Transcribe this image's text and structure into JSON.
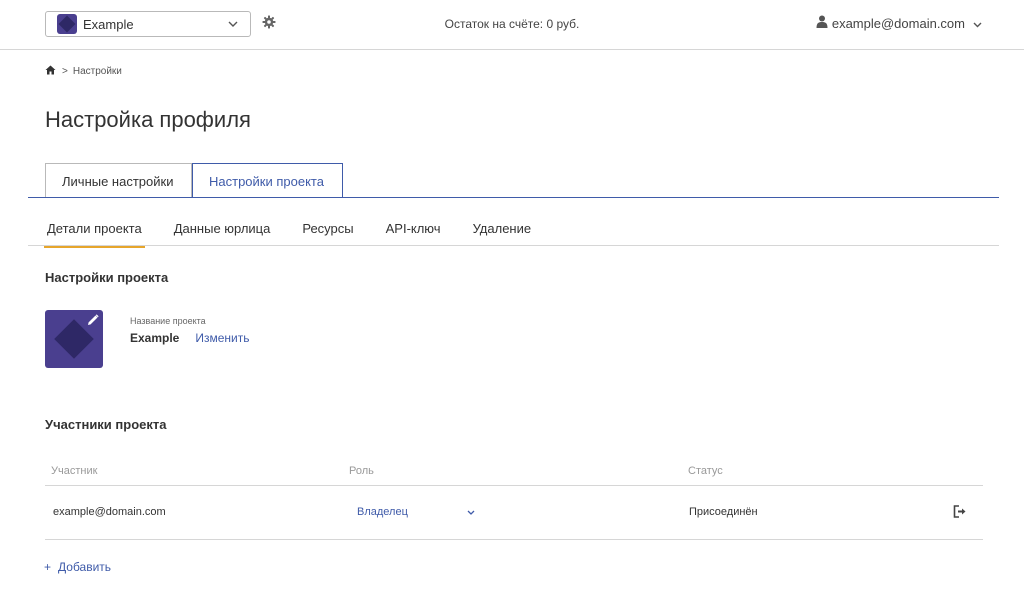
{
  "colors": {
    "accent": "#3f5ba9",
    "brand_purple": "#4a3f8f",
    "brand_dark": "#2e2866",
    "tab_underline": "#e6a52b"
  },
  "header": {
    "project_name": "Example",
    "balance_text": "Остаток на счёте: 0 руб.",
    "user_email": "example@domain.com"
  },
  "breadcrumb": {
    "current": "Настройки"
  },
  "page_title": "Настройка профиля",
  "main_tabs": [
    {
      "label": "Личные настройки",
      "active": false
    },
    {
      "label": "Настройки проекта",
      "active": true
    }
  ],
  "sub_tabs": [
    {
      "label": "Детали проекта",
      "active": true
    },
    {
      "label": "Данные юрлица",
      "active": false
    },
    {
      "label": "Ресурсы",
      "active": false
    },
    {
      "label": "API-ключ",
      "active": false
    },
    {
      "label": "Удаление",
      "active": false
    }
  ],
  "project_settings": {
    "title": "Настройки проекта",
    "name_label": "Название проекта",
    "name_value": "Example",
    "edit_label": "Изменить"
  },
  "members": {
    "title": "Участники проекта",
    "columns": [
      "Участник",
      "Роль",
      "Статус"
    ],
    "rows": [
      {
        "email": "example@domain.com",
        "role": "Владелец",
        "status": "Присоединён"
      }
    ],
    "add_label": "Добавить"
  },
  "icons": {
    "gear": "gear-icon",
    "user": "user-icon",
    "home": "home-icon",
    "chevron": "chevron-down-icon",
    "pencil": "pencil-icon",
    "leave": "sign-out-icon",
    "plus": "plus-icon"
  }
}
